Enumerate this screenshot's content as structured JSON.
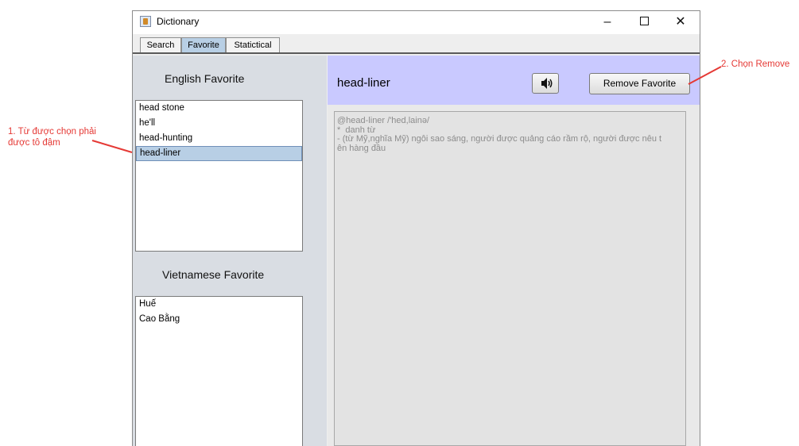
{
  "window": {
    "title": "Dictionary",
    "controls": {
      "minimize": "–",
      "close": "✕"
    }
  },
  "tabs": [
    {
      "label": "Search",
      "active": false
    },
    {
      "label": "Favorite",
      "active": true
    },
    {
      "label": "Statictical",
      "active": false
    }
  ],
  "english_favorite": {
    "title": "English Favorite",
    "items": [
      "head stone",
      "he'll",
      "head-hunting",
      "head-liner"
    ],
    "selected_index": 3
  },
  "vietnamese_favorite": {
    "title": "Vietnamese Favorite",
    "items": [
      "Huế",
      "Cao Bằng"
    ]
  },
  "detail": {
    "word": "head-liner",
    "speaker_icon": "speaker-icon",
    "remove_button": "Remove Favorite",
    "definition": {
      "line1": "@head-liner /'hed,lainə/",
      "line2": "*  danh từ",
      "line3": "- (từ Mỹ,nghĩa Mỹ) ngôi sao sáng, người được quảng cáo rầm rộ, người được nêu t",
      "line4": "ên hàng đầu"
    }
  },
  "annotations": {
    "note1_line1": "1. Từ được chọn phải",
    "note1_line2": "được tô đậm",
    "note2": "2. Chọn Remove"
  },
  "colors": {
    "annotation_red": "#e53935",
    "header_bar": "#c9c9ff",
    "selection": "#b8cfe5"
  }
}
